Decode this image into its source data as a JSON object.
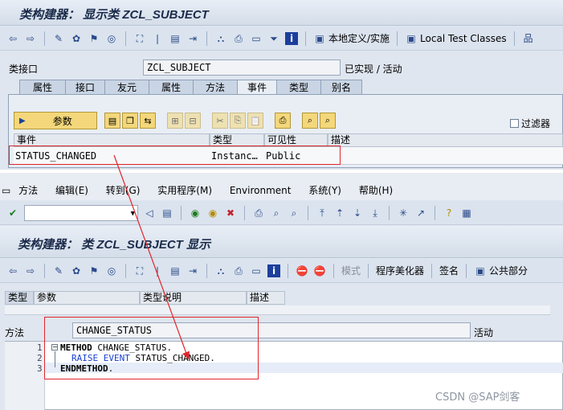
{
  "top": {
    "title": "类构建器： 显示类 ZCL_SUBJECT",
    "toolbar_local_def": "本地定义/实施",
    "toolbar_test_classes": "Local Test Classes",
    "class_label": "类接口",
    "class_value": "ZCL_SUBJECT",
    "status": "已实现 / 活动",
    "tabs": [
      "属性",
      "接口",
      "友元",
      "属性",
      "方法",
      "事件",
      "类型",
      "别名"
    ],
    "params_button": "参数",
    "filter_label": "过滤器",
    "grid_headers": [
      "事件",
      "类型",
      "可见性",
      "描述"
    ],
    "row": {
      "event": "STATUS_CHANGED",
      "type": "Instanc…",
      "visibility": "Public",
      "desc": ""
    }
  },
  "bottom": {
    "menu": [
      "方法",
      "编辑(E)",
      "转到(G)",
      "实用程序(M)",
      "Environment",
      "系统(Y)",
      "帮助(H)"
    ],
    "title": "类构建器： 类 ZCL_SUBJECT 显示",
    "toolbar_mode": "模式",
    "toolbar_pretty": "程序美化器",
    "toolbar_sign": "签名",
    "toolbar_public": "公共部分",
    "param_tabs": [
      "类型",
      "参数",
      "类型说明",
      "描述"
    ],
    "method_label": "方法",
    "method_value": "CHANGE_STATUS",
    "method_status": "活动",
    "code": {
      "line_numbers": [
        "1",
        "2",
        "3"
      ],
      "line1_kw": "METHOD",
      "line1_rest": " CHANGE_STATUS.",
      "line2_kw": "RAISE EVENT",
      "line2_rest": " STATUS_CHANGED.",
      "line3_kw": "ENDMETHOD",
      "line3_rest": "."
    }
  },
  "watermark": "CSDN @SAP剑客",
  "colors": {
    "highlight_red": "#e0262c",
    "keyword_blue": "#1a3fd0",
    "panel": "#dfe6ef"
  }
}
